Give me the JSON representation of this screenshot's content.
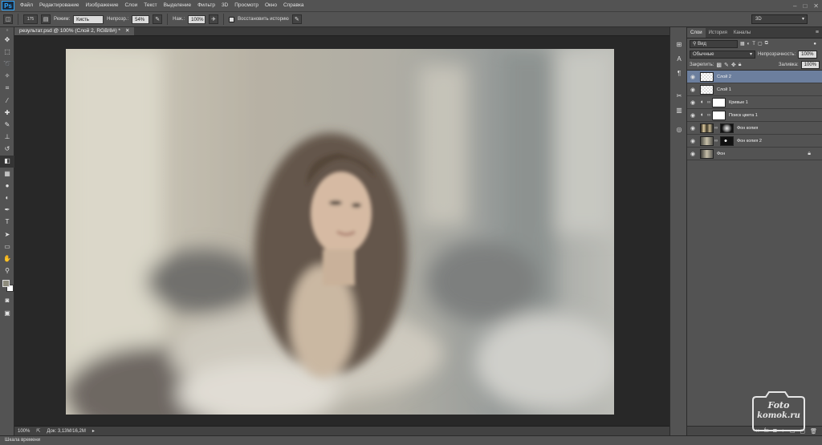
{
  "app": {
    "logo": "Ps"
  },
  "menu": [
    "Файл",
    "Редактирование",
    "Изображение",
    "Слои",
    "Текст",
    "Выделение",
    "Фильтр",
    "3D",
    "Просмотр",
    "Окно",
    "Справка"
  ],
  "options": {
    "brush_size": "175",
    "mode_label": "Режим:",
    "mode_value": "Кисть",
    "opacity_label": "Непрозр.:",
    "opacity_value": "54%",
    "flow_label": "Наж.:",
    "flow_value": "100%",
    "erase_history_label": "Восстановить историю",
    "workspace": "3D"
  },
  "document": {
    "tab_title": "результат.psd @ 100% (Слой 2, RGB/8#) *",
    "zoom": "100%",
    "doc_info": "Док: 3,13M/16,2M"
  },
  "timeline_label": "Шкала времени",
  "layers_panel": {
    "tabs": [
      "Слои",
      "История",
      "Каналы"
    ],
    "kind_label": "Вид",
    "blend_mode": "Обычные",
    "opacity_label": "Непрозрачность:",
    "opacity_value": "100%",
    "lock_label": "Закрепить:",
    "fill_label": "Заливка:",
    "fill_value": "100%",
    "layers": [
      {
        "name": "Слой 2",
        "selected": true
      },
      {
        "name": "Слой 1",
        "selected": false
      },
      {
        "name": "Кривые 1",
        "selected": false
      },
      {
        "name": "Поиск цвета 1",
        "selected": false
      },
      {
        "name": "Фон копия",
        "selected": false
      },
      {
        "name": "Фон копия 2",
        "selected": false
      },
      {
        "name": "Фон",
        "selected": false
      }
    ]
  },
  "watermark": {
    "line1": "Foto",
    "line2": "komok.ru"
  }
}
